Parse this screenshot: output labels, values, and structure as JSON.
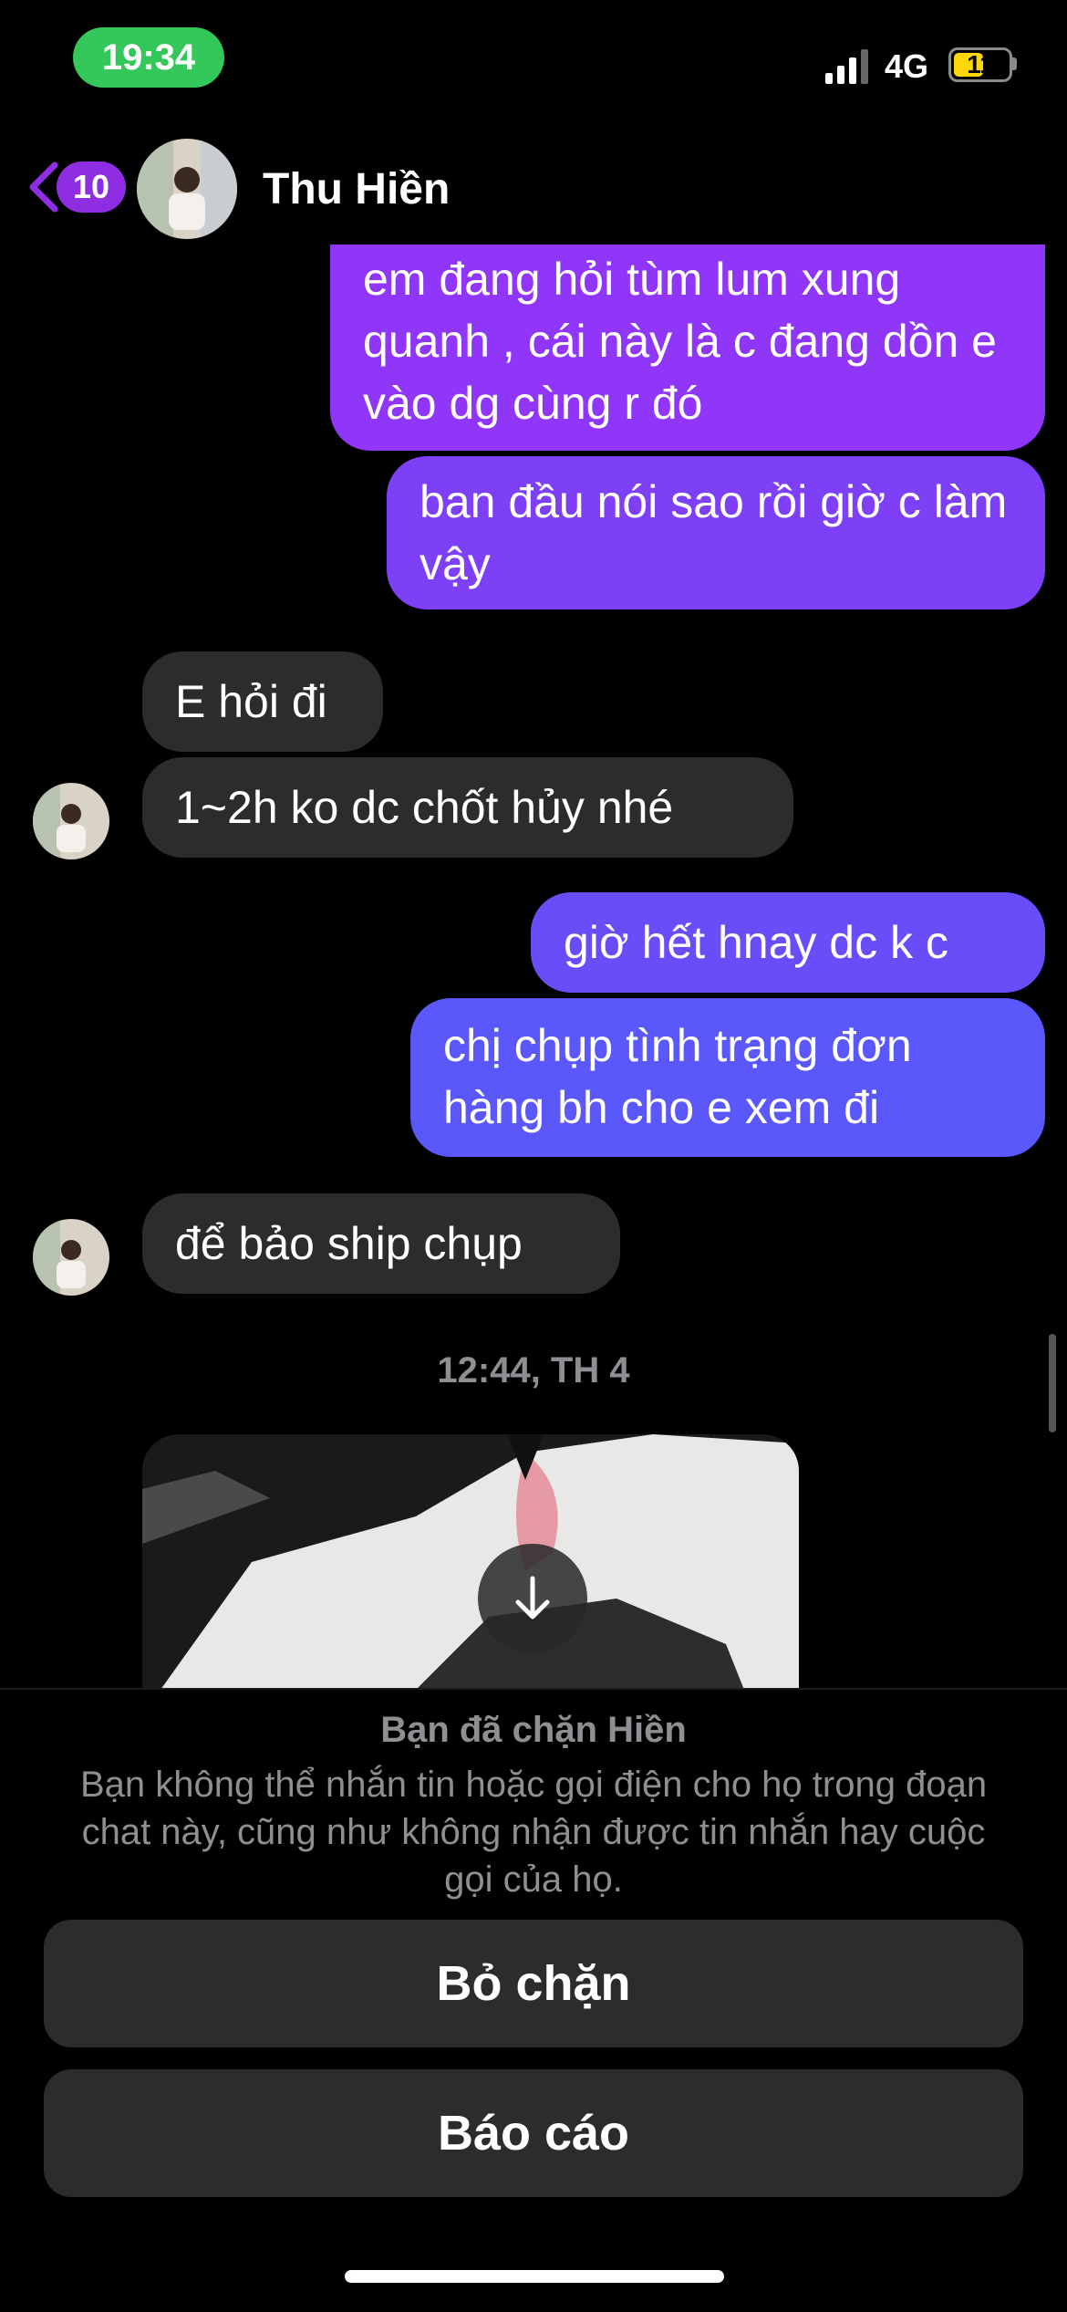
{
  "status_bar": {
    "time": "19:34",
    "network": "4G",
    "battery": "11",
    "battery_level": 0.11
  },
  "header": {
    "back_count": "10",
    "contact_name": "Thu Hiền"
  },
  "messages": [
    {
      "direction": "out",
      "text": "em đang hỏi tùm lum xung quanh , cái này là c đang dồn e vào dg cùng r đó"
    },
    {
      "direction": "out",
      "text": "ban đầu nói sao rồi giờ c làm vậy"
    },
    {
      "direction": "in",
      "text": "E hỏi đi"
    },
    {
      "direction": "in",
      "text": "1~2h ko dc chốt hủy nhé"
    },
    {
      "direction": "out",
      "text": "giờ hết hnay dc k c"
    },
    {
      "direction": "out",
      "text": "chị chụp tình trạng đơn hàng bh cho e xem đi"
    },
    {
      "direction": "in",
      "text": "để bảo ship chụp"
    }
  ],
  "timestamp": "12:44, TH 4",
  "block_notice": {
    "title": "Bạn đã chặn Hiền",
    "description": "Bạn không thể nhắn tin hoặc gọi điện cho họ trong đoạn chat này, cũng như không nhận được tin nhắn hay cuộc gọi của họ."
  },
  "actions": {
    "unblock": "Bỏ chặn",
    "report": "Báo cáo"
  },
  "colors": {
    "accent": "#8e2de2",
    "bubble_out_top": "#9b30ff",
    "bubble_out_bottom": "#5b5bff",
    "bubble_in": "#2c2c2e",
    "status_green": "#34c759"
  }
}
